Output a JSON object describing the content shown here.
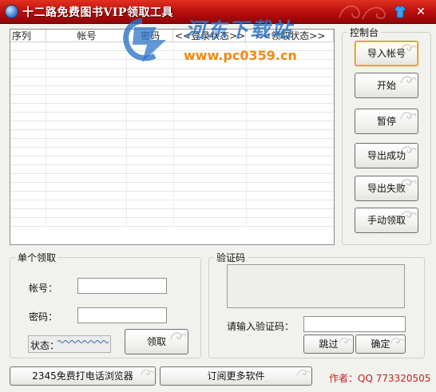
{
  "window": {
    "title": "十二路免费图书VIP领取工具"
  },
  "watermark": {
    "site_name": "河东下载站",
    "url": "www.pc0359.cn"
  },
  "table": {
    "columns": [
      "序列",
      "帐号",
      "密码",
      "<<登录状态>>",
      "<<领取状态>>"
    ],
    "rows": []
  },
  "control_panel": {
    "label": "控制台",
    "buttons": {
      "import": "导入帐号",
      "start": "开始",
      "pause": "暂停",
      "export_success": "导出成功",
      "export_fail": "导出失败",
      "manual_claim": "手动领取"
    }
  },
  "single_claim": {
    "label": "单个领取",
    "account_label": "帐号：",
    "account_value": "",
    "password_label": "密码：",
    "password_value": "",
    "status_label": "状态：",
    "claim_button": "领取"
  },
  "captcha": {
    "label": "验证码",
    "input_label": "请输入验证码：",
    "input_value": "",
    "skip_button": "跳过",
    "confirm_button": "确定"
  },
  "footer": {
    "browser_button": "2345免费打电话浏览器",
    "subscribe_button": "订阅更多软件",
    "author": "作者：QQ 773320505"
  },
  "colors": {
    "title_bar": "#b60d0d",
    "watermark_blue": "#2f76c8",
    "watermark_orange": "#f08a12",
    "author_red": "#c82020",
    "active_button_border": "#d88800"
  }
}
